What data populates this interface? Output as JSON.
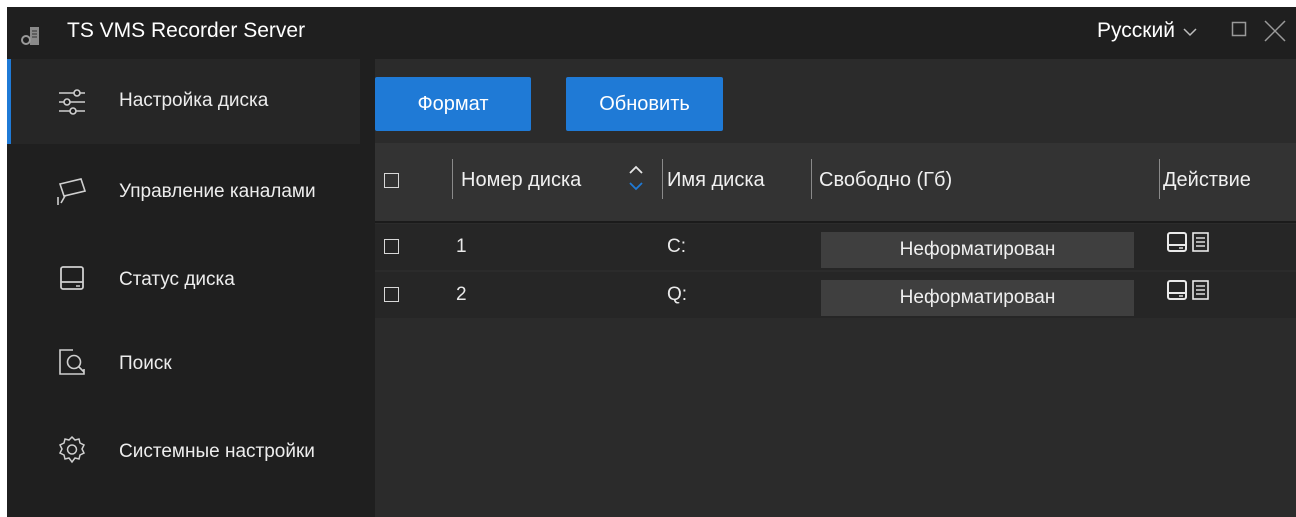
{
  "window": {
    "title": "TS VMS Recorder Server",
    "language": "Русский",
    "icons": [
      "app-icon",
      "chevron-down-icon",
      "maximize-icon",
      "close-icon"
    ]
  },
  "colors": {
    "accent": "#1f7ad6",
    "background": "#1f1f1f",
    "panel": "#2b2b2b",
    "row": "#262626",
    "badge": "#3f3f3f"
  },
  "sidebar": {
    "items": [
      {
        "label": "Настройка диска",
        "icon": "sliders-icon",
        "active": true
      },
      {
        "label": "Управление каналами",
        "icon": "camera-icon",
        "active": false
      },
      {
        "label": "Статус диска",
        "icon": "hard-drive-icon",
        "active": false
      },
      {
        "label": "Поиск",
        "icon": "search-icon",
        "active": false
      },
      {
        "label": "Системные настройки",
        "icon": "gear-icon",
        "active": false
      }
    ]
  },
  "toolbar": {
    "format_label": "Формат",
    "refresh_label": "Обновить"
  },
  "table": {
    "columns": [
      "Номер диска",
      "Имя диска",
      "Свободно (Гб)",
      "Действие"
    ],
    "sort_column": "Номер диска",
    "rows": [
      {
        "number": "1",
        "name": "C:",
        "free": "Неформатирован",
        "actions": [
          "drive-icon",
          "list-icon"
        ]
      },
      {
        "number": "2",
        "name": "Q:",
        "free": "Неформатирован",
        "actions": [
          "drive-icon",
          "list-icon"
        ]
      }
    ]
  }
}
